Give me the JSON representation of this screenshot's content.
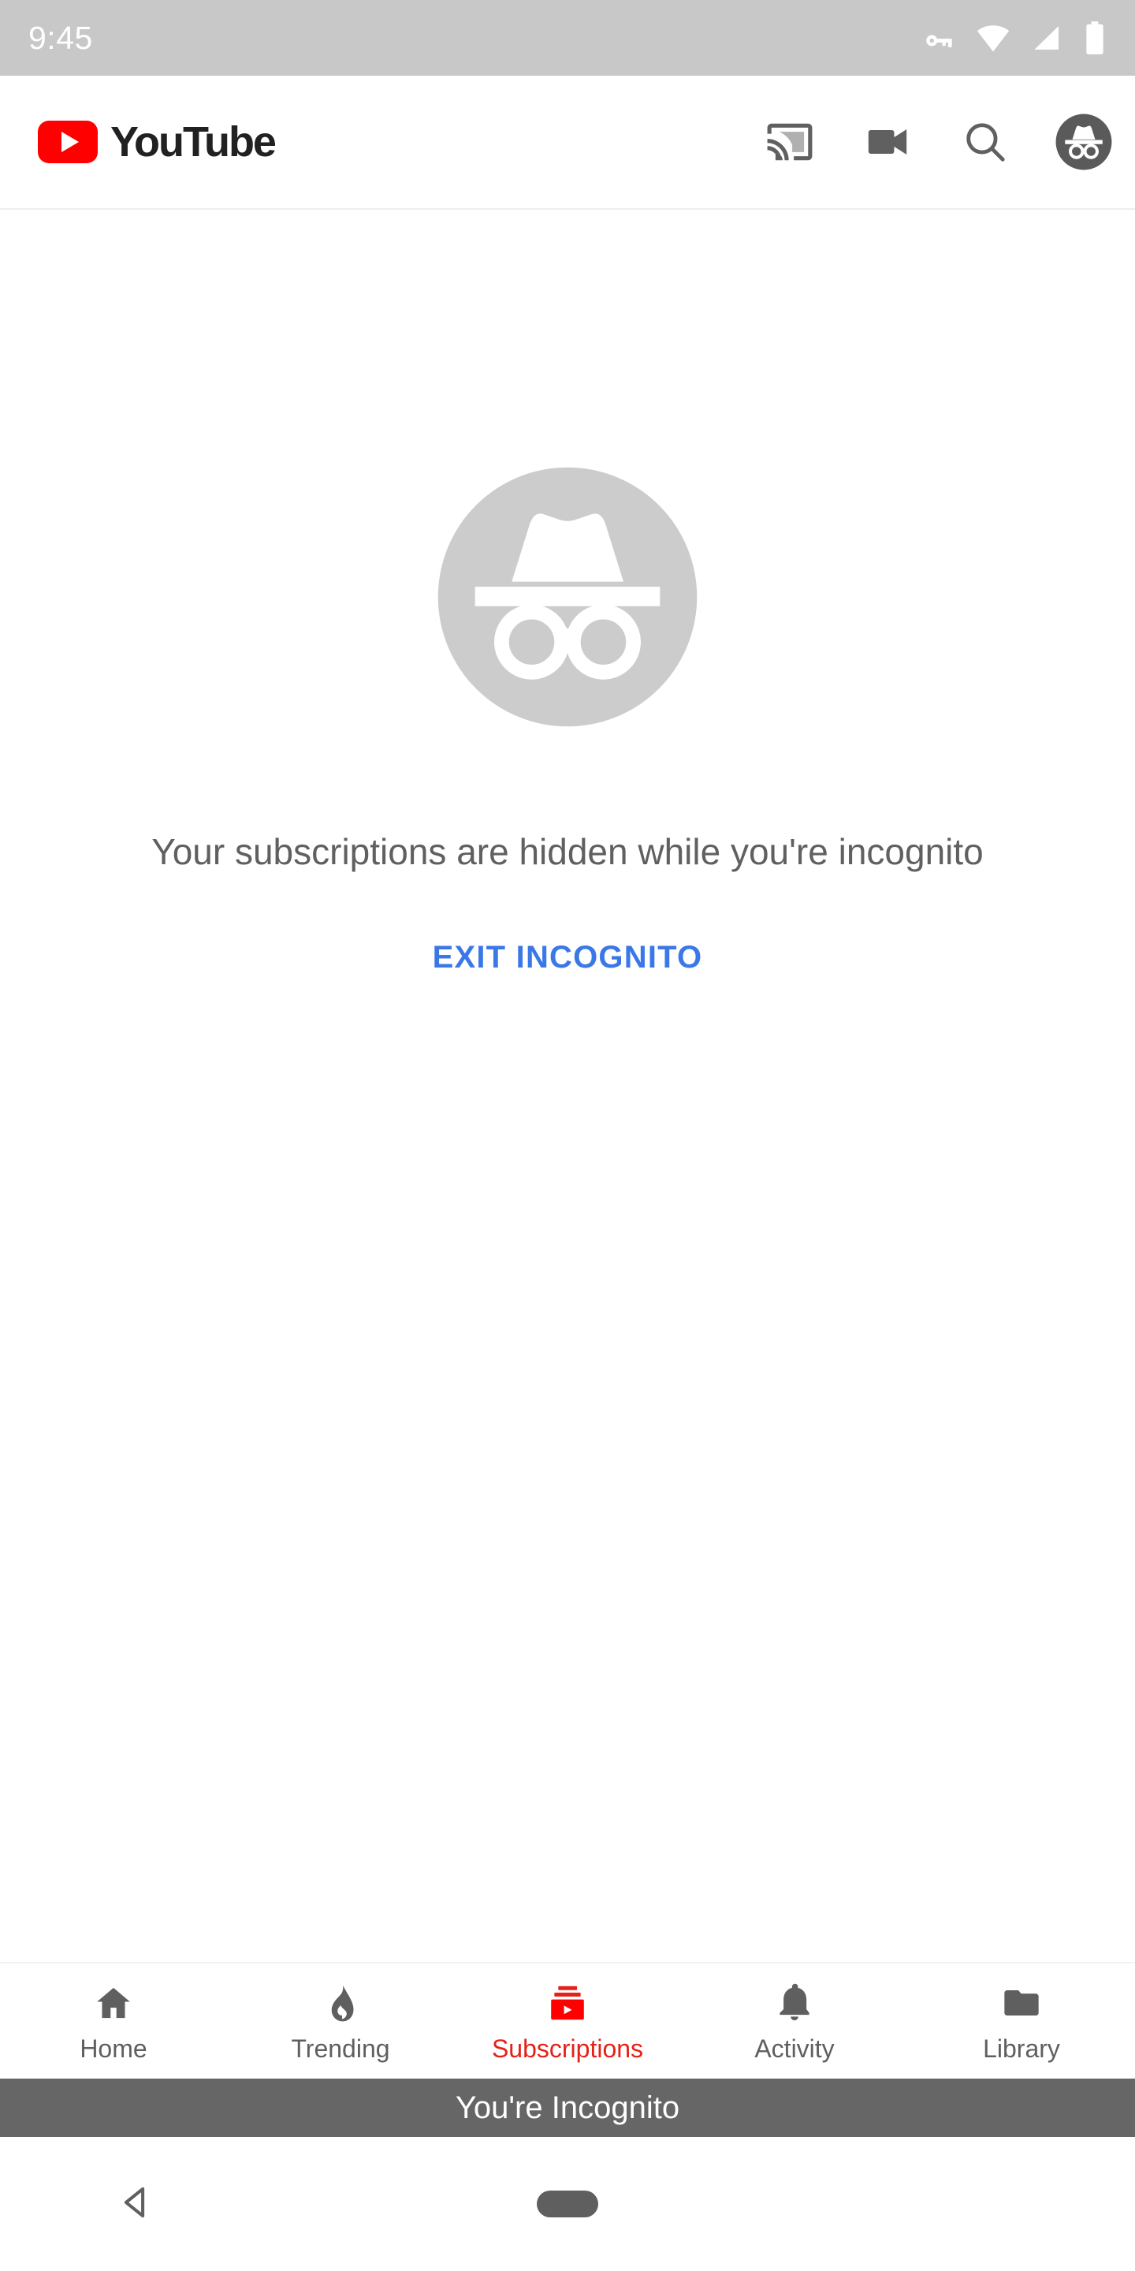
{
  "status_bar": {
    "time": "9:45",
    "icons": [
      "vpn-key-icon",
      "wifi-icon",
      "cellular-signal-icon",
      "battery-icon"
    ],
    "background_color": "#c8c8c8",
    "foreground_color": "#ffffff"
  },
  "header": {
    "brand_text": "YouTube",
    "brand_color": "#ff0000",
    "icons": [
      "cast-icon",
      "video-camera-icon",
      "search-icon",
      "incognito-avatar-icon"
    ],
    "icon_color": "#606060"
  },
  "main": {
    "illustration": "incognito-illustration",
    "illustration_color": "#cccccc",
    "message": "Your subscriptions are hidden while you're incognito",
    "message_color": "#606060",
    "exit_label": "EXIT INCOGNITO",
    "exit_color": "#3b78e7"
  },
  "tab_bar": {
    "active_color": "#e52117",
    "inactive_color": "#5f5f5f",
    "tabs": [
      {
        "label": "Home",
        "icon": "home-icon",
        "active": false
      },
      {
        "label": "Trending",
        "icon": "flame-icon",
        "active": false
      },
      {
        "label": "Subscriptions",
        "icon": "subscriptions-icon",
        "active": true
      },
      {
        "label": "Activity",
        "icon": "bell-icon",
        "active": false
      },
      {
        "label": "Library",
        "icon": "folder-icon",
        "active": false
      }
    ]
  },
  "incognito_banner": {
    "text": "You're Incognito",
    "background_color": "#666666",
    "text_color": "#ffffff"
  },
  "android_nav": {
    "buttons": [
      "back-button",
      "home-button"
    ],
    "color": "#5f5f5f"
  }
}
